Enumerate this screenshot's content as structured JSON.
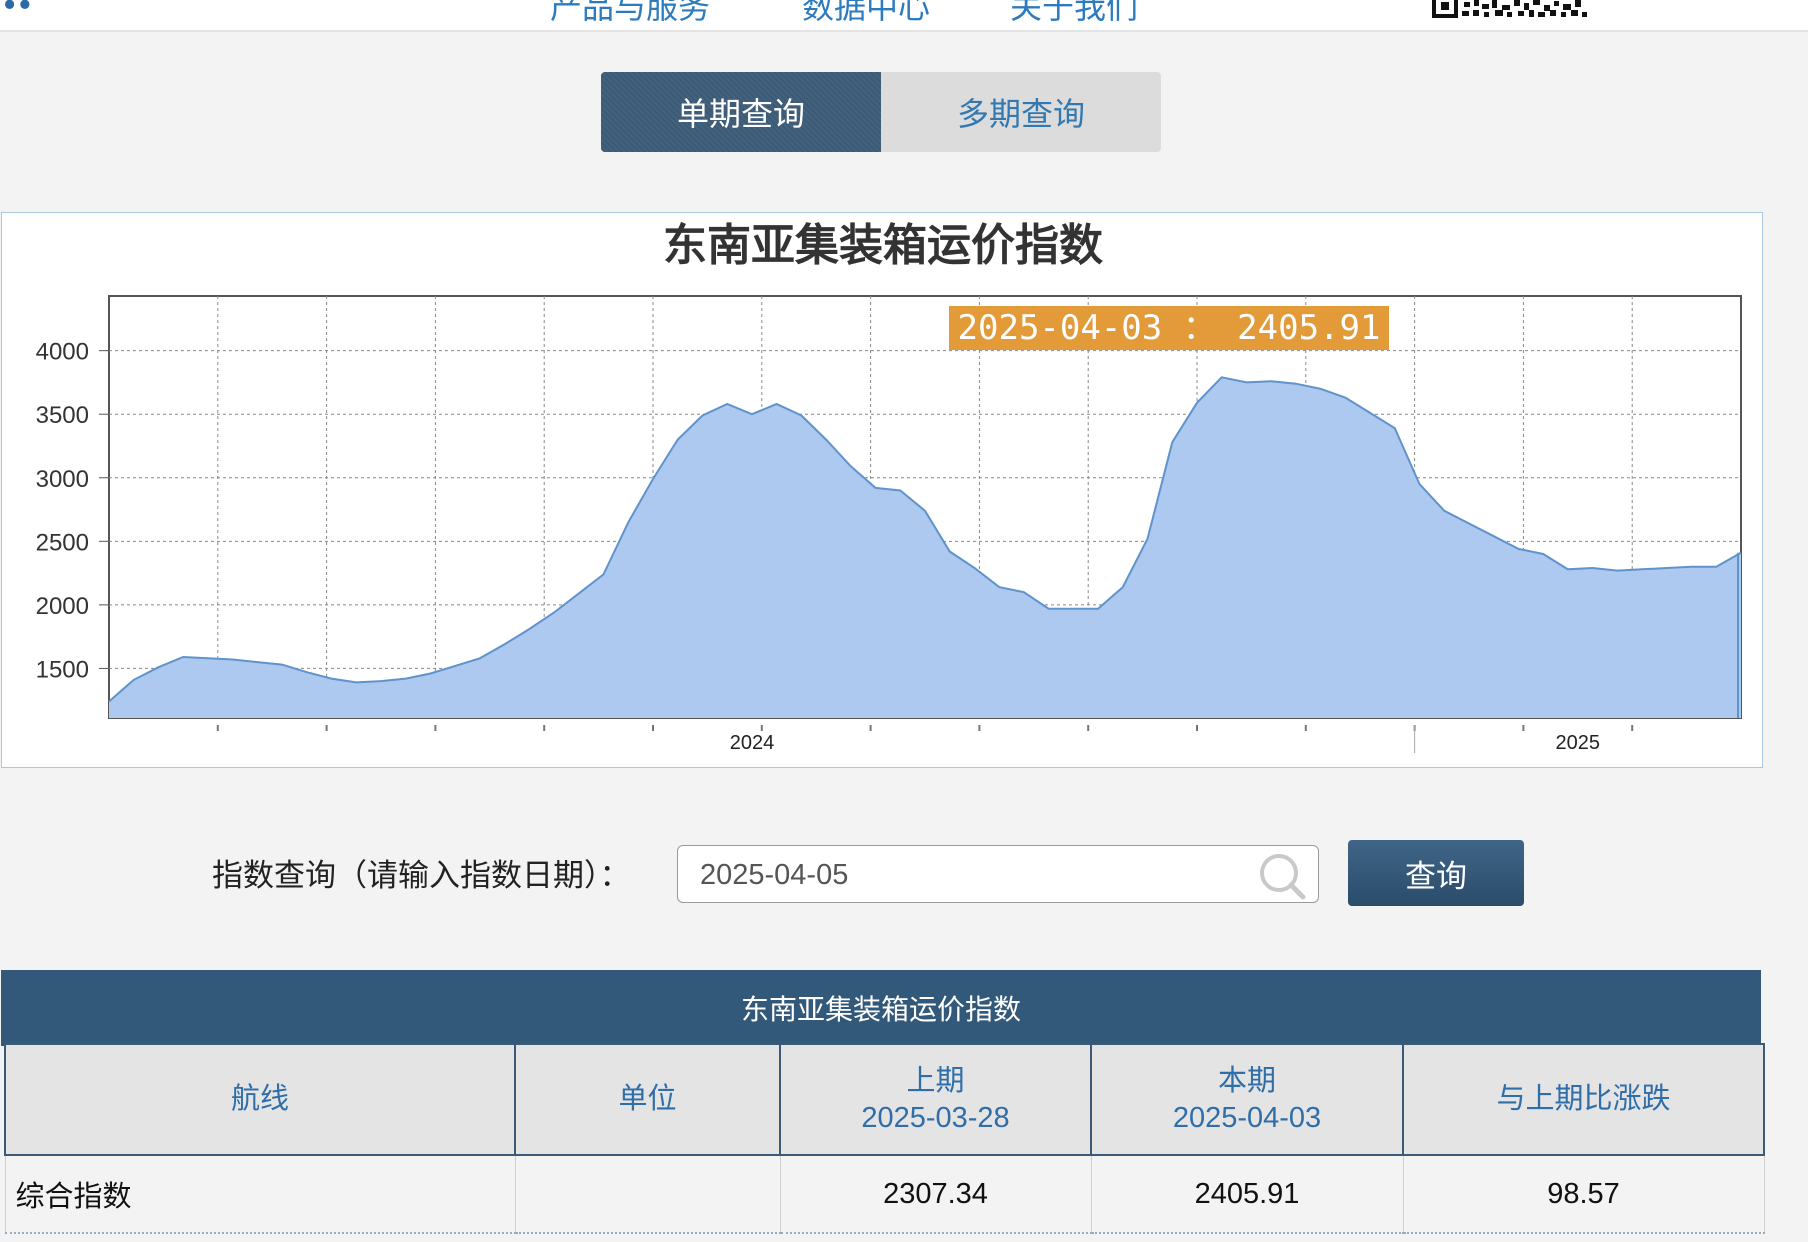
{
  "header": {
    "nav_items": [
      "产品与服务",
      "数据中心",
      "关于我们"
    ]
  },
  "tabs": {
    "single": "单期查询",
    "multi": "多期查询"
  },
  "chart_data": {
    "type": "area",
    "title": "东南亚集装箱运价指数",
    "tooltip": "2025-04-03 ： 2405.91",
    "y_ticks": [
      "4000",
      "3500",
      "3000",
      "2500",
      "2000",
      "1500"
    ],
    "ylim": [
      1110,
      4430
    ],
    "x_year_labels": [
      "2024",
      "2025"
    ],
    "grid": true,
    "values": [
      1240,
      1410,
      1510,
      1590,
      1580,
      1570,
      1550,
      1530,
      1470,
      1420,
      1390,
      1400,
      1420,
      1460,
      1520,
      1580,
      1690,
      1810,
      1940,
      2090,
      2240,
      2650,
      2990,
      3300,
      3490,
      3580,
      3500,
      3580,
      3490,
      3300,
      3090,
      2920,
      2900,
      2740,
      2420,
      2290,
      2140,
      2100,
      1970,
      1970,
      1970,
      2140,
      2520,
      3280,
      3590,
      3790,
      3750,
      3760,
      3740,
      3700,
      3630,
      3510,
      3390,
      2950,
      2740,
      2640,
      2540,
      2440,
      2400,
      2280,
      2290,
      2270,
      2280,
      2290,
      2300,
      2300,
      2410
    ]
  },
  "query": {
    "label": "指数查询（请输入指数日期）：",
    "input_value": "2025-04-05",
    "button": "查询"
  },
  "table": {
    "title": "东南亚集装箱运价指数",
    "headers": {
      "route": "航线",
      "unit": "单位",
      "prev_label": "上期",
      "prev_date": "2025-03-28",
      "curr_label": "本期",
      "curr_date": "2025-04-03",
      "change": "与上期比涨跌"
    },
    "rows": [
      {
        "route": "综合指数",
        "unit": "",
        "prev": "2307.34",
        "curr": "2405.91",
        "change": "98.57"
      }
    ]
  },
  "colors": {
    "accent": "#33597a",
    "area_fill": "#adc9f0",
    "area_line": "#5f93cc",
    "tooltip_bg": "#e39a38",
    "link": "#2f6ea8"
  }
}
